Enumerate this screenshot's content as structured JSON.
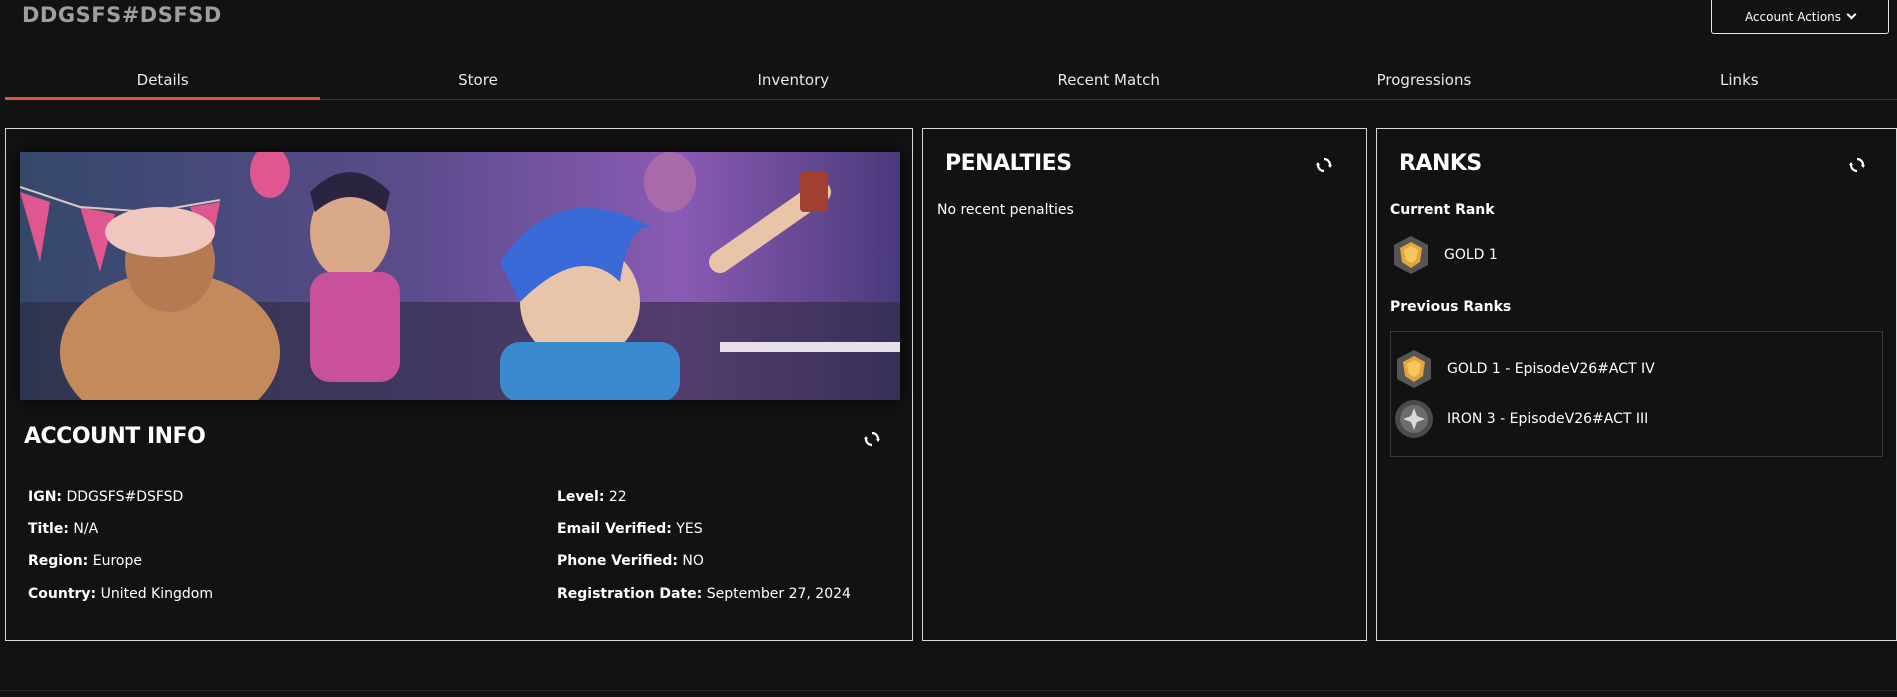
{
  "header": {
    "player_name": "DDGSFS#DSFSD",
    "actions_label": "Account Actions"
  },
  "tabs": [
    {
      "label": "Details",
      "active": true
    },
    {
      "label": "Store",
      "active": false
    },
    {
      "label": "Inventory",
      "active": false
    },
    {
      "label": "Recent Match",
      "active": false
    },
    {
      "label": "Progressions",
      "active": false
    },
    {
      "label": "Links",
      "active": false
    }
  ],
  "account": {
    "title": "ACCOUNT INFO",
    "left": [
      {
        "label": "IGN:",
        "value": "DDGSFS#DSFSD"
      },
      {
        "label": "Title:",
        "value": "N/A"
      },
      {
        "label": "Region:",
        "value": "Europe"
      },
      {
        "label": "Country:",
        "value": "United Kingdom"
      }
    ],
    "right": [
      {
        "label": "Level:",
        "value": "22"
      },
      {
        "label": "Email Verified:",
        "value": "YES"
      },
      {
        "label": "Phone Verified:",
        "value": "NO"
      },
      {
        "label": "Registration Date:",
        "value": "September 27, 2024"
      }
    ]
  },
  "penalties": {
    "title": "PENALTIES",
    "message": "No recent penalties"
  },
  "ranks": {
    "title": "RANKS",
    "current_label": "Current Rank",
    "current": {
      "name": "GOLD 1",
      "tier": "gold"
    },
    "previous_label": "Previous Ranks",
    "previous": [
      {
        "name": "GOLD 1 - EpisodeV26#ACT IV",
        "tier": "gold"
      },
      {
        "name": "IRON 3 - EpisodeV26#ACT III",
        "tier": "iron"
      }
    ]
  },
  "colors": {
    "accent": "#e0533d",
    "background": "#121212",
    "border": "#d9d9d9"
  },
  "icons": {
    "refresh": "refresh-icon",
    "chevron": "chevron-down-icon"
  }
}
